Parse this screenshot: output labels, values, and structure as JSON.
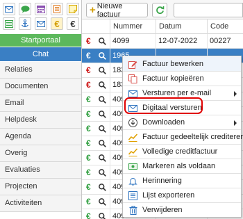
{
  "sidebar": {
    "icons_row1": [
      "envelope-icon",
      "chat-icon",
      "calendar-icon",
      "document-icon",
      "note-icon"
    ],
    "icons_row2": [
      "list-icon",
      "anchor-icon",
      "envelope-icon",
      "euro-icon",
      "euro-icon"
    ],
    "startportaal_label": "Startportaal",
    "chat_label": "Chat",
    "nav": [
      "Relaties",
      "Documenten",
      "Email",
      "Helpdesk",
      "Agenda",
      "Overig",
      "Evaluaties",
      "Projecten",
      "Activiteiten"
    ],
    "colors": {
      "green": "#5cb85c",
      "blue": "#3a7fc4"
    }
  },
  "toolbar": {
    "new_invoice_label": "Nieuwe factuur",
    "search_value": ""
  },
  "table": {
    "columns": [
      "Nummer",
      "Datum",
      "Code"
    ],
    "currency_symbol": "€",
    "rows": [
      {
        "nummer": "4099",
        "datum": "12-07-2022",
        "code": "00227",
        "selected": false
      },
      {
        "nummer": "1965",
        "datum": "",
        "code": "",
        "selected": true
      },
      {
        "nummer": "183",
        "datum": "",
        "code": "",
        "selected": false
      },
      {
        "nummer": "183",
        "datum": "",
        "code": "",
        "selected": false
      },
      {
        "nummer": "409",
        "datum": "",
        "code": "",
        "selected": false
      },
      {
        "nummer": "409",
        "datum": "",
        "code": "",
        "selected": false
      },
      {
        "nummer": "409",
        "datum": "",
        "code": "",
        "selected": false
      },
      {
        "nummer": "409",
        "datum": "",
        "code": "",
        "selected": false
      },
      {
        "nummer": "409",
        "datum": "",
        "code": "",
        "selected": false
      },
      {
        "nummer": "409",
        "datum": "",
        "code": "",
        "selected": false
      },
      {
        "nummer": "409",
        "datum": "",
        "code": "",
        "selected": false
      },
      {
        "nummer": "409",
        "datum": "",
        "code": "",
        "selected": false
      },
      {
        "nummer": "409",
        "datum": "",
        "code": "",
        "selected": false
      }
    ]
  },
  "context_menu": {
    "items": [
      {
        "label": "Factuur bewerken",
        "icon": "edit-icon",
        "submenu": false,
        "hover": true
      },
      {
        "label": "Factuur kopieëren",
        "icon": "copy-icon",
        "submenu": false,
        "hover": false
      },
      {
        "label": "Versturen per e-mail",
        "icon": "envelope-icon",
        "submenu": true,
        "hover": false
      },
      {
        "label": "Digitaal versturen",
        "icon": "envelope-icon",
        "submenu": false,
        "hover": false,
        "highlighted": true
      },
      {
        "label": "Downloaden",
        "icon": "download-icon",
        "submenu": true,
        "hover": false
      },
      {
        "label": "Factuur gedeeltelijk crediteren",
        "icon": "credit-icon",
        "submenu": false,
        "hover": false
      },
      {
        "label": "Volledige creditfactuur",
        "icon": "credit-icon",
        "submenu": false,
        "hover": false
      },
      {
        "label": "Markeren als voldaan",
        "icon": "money-icon",
        "submenu": false,
        "hover": false
      },
      {
        "label": "Herinnering",
        "icon": "bell-icon",
        "submenu": false,
        "hover": false
      },
      {
        "label": "Lijst exporteren",
        "icon": "export-icon",
        "submenu": false,
        "hover": false
      },
      {
        "label": "Verwijderen",
        "icon": "trash-icon",
        "submenu": false,
        "hover": false
      }
    ],
    "highlight_color": "#e00000"
  }
}
